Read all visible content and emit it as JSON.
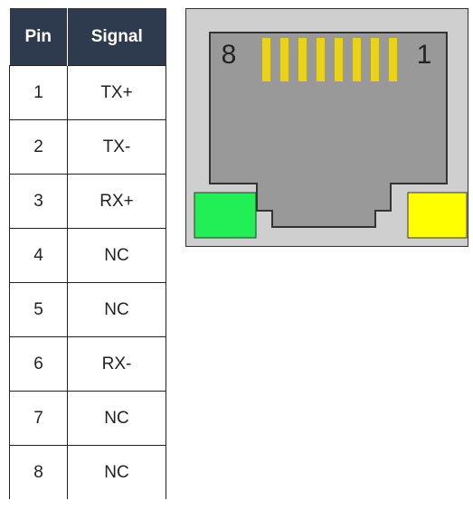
{
  "table": {
    "headers": {
      "pin": "Pin",
      "signal": "Signal"
    },
    "rows": [
      {
        "pin": "1",
        "signal": "TX+"
      },
      {
        "pin": "2",
        "signal": "TX-"
      },
      {
        "pin": "3",
        "signal": "RX+"
      },
      {
        "pin": "4",
        "signal": "NC"
      },
      {
        "pin": "5",
        "signal": "NC"
      },
      {
        "pin": "6",
        "signal": "RX-"
      },
      {
        "pin": "7",
        "signal": "NC"
      },
      {
        "pin": "8",
        "signal": "NC"
      }
    ]
  },
  "connector": {
    "left_pin_label": "8",
    "right_pin_label": "1",
    "contact_count": 8,
    "colors": {
      "frame": "#cfcfcf",
      "body": "#999999",
      "contacts": "#e8d21a",
      "left_led": "#22ee55",
      "right_led": "#ffff00",
      "outline": "#333333"
    }
  }
}
